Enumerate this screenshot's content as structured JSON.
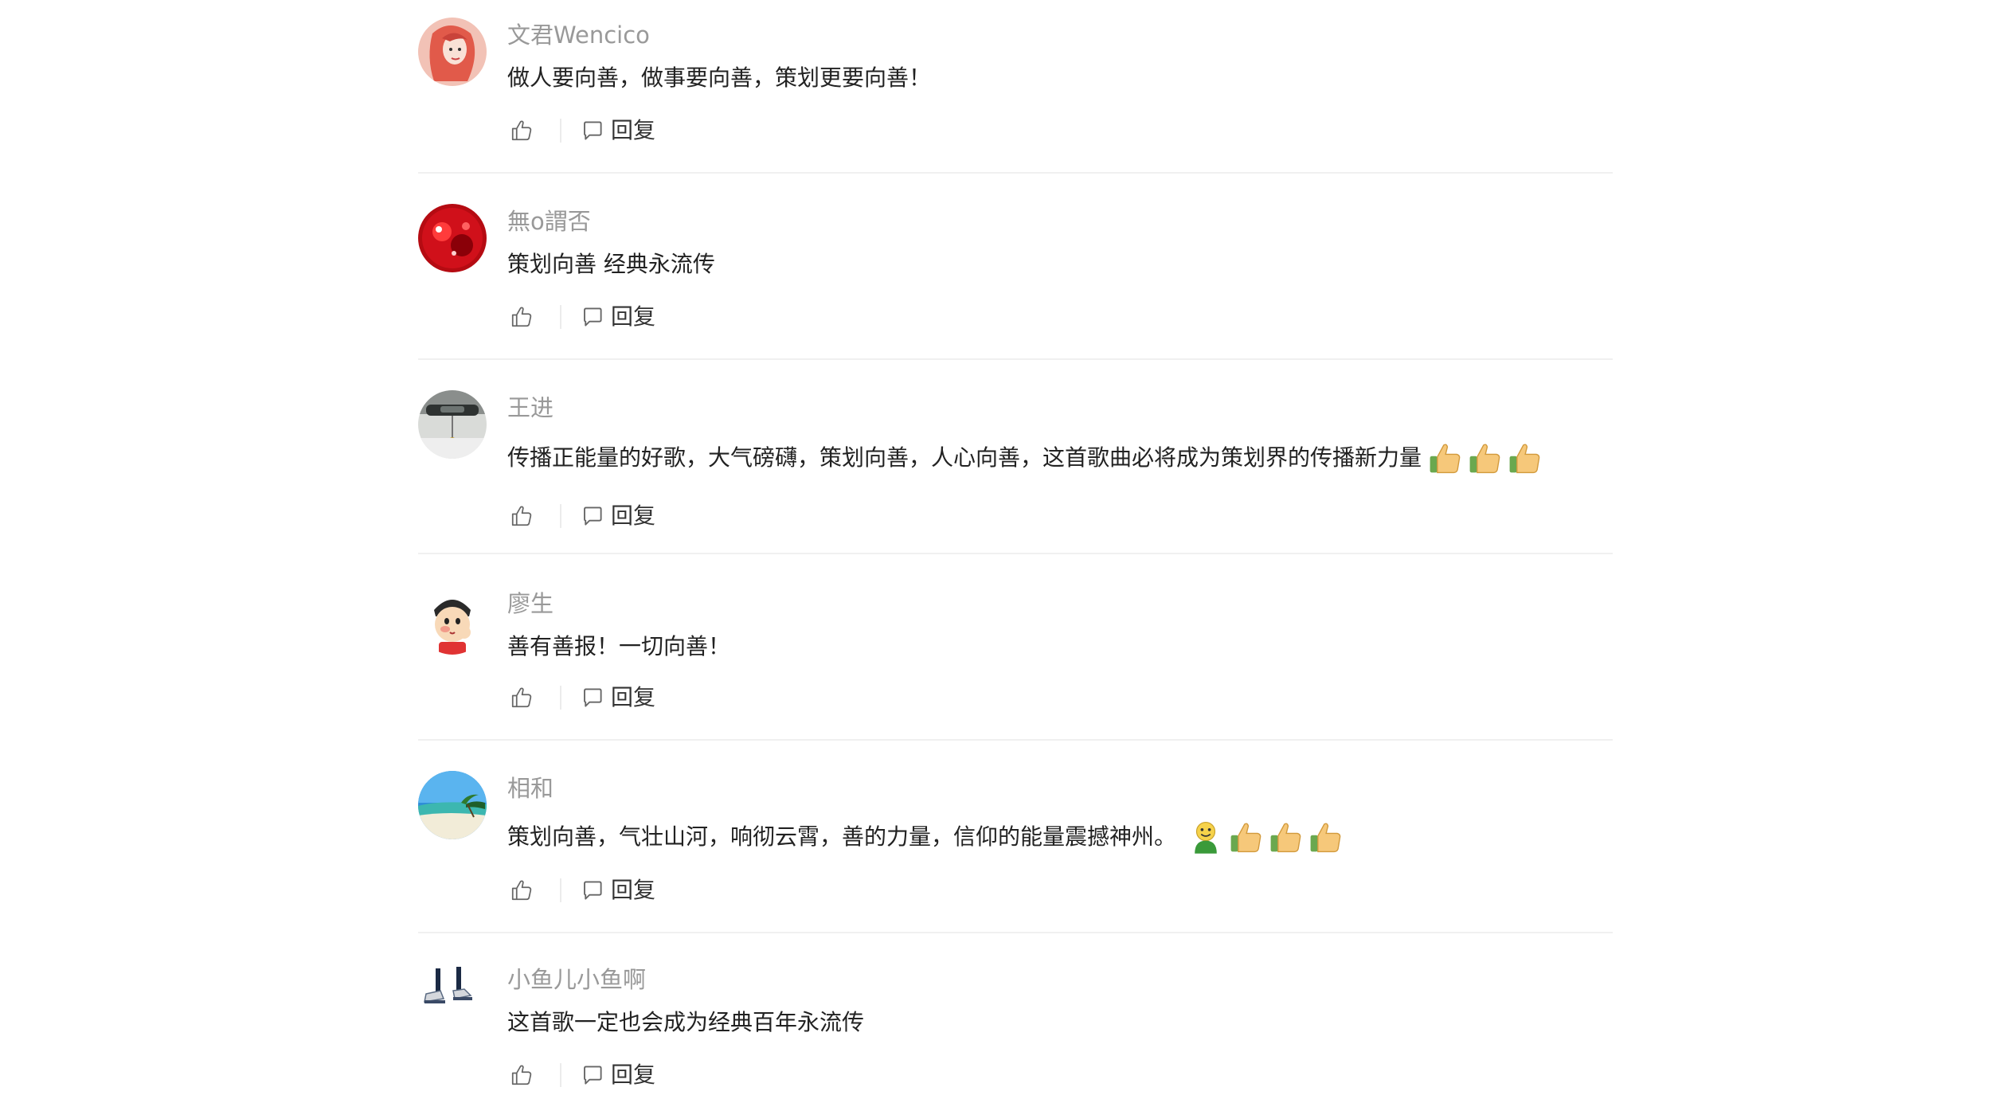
{
  "comments": [
    {
      "username": "文君Wencico",
      "content": "做人要向善，做事要向善，策划更要向善！",
      "emojis": [],
      "reply_label": "回复",
      "avatar": "woman-portrait-avatar"
    },
    {
      "username": "無o謂否",
      "content": "策划向善 经典永流传",
      "emojis": [],
      "reply_label": "回复",
      "avatar": "red-abstract-avatar"
    },
    {
      "username": "王进",
      "content": "传播正能量的好歌，大气磅礴，策划向善，人心向善，这首歌曲必将成为策划界的传播新力量",
      "emojis": [
        "thumbs-up",
        "thumbs-up",
        "thumbs-up"
      ],
      "reply_label": "回复",
      "avatar": "car-interior-avatar"
    },
    {
      "username": "廖生",
      "content": "善有善报！一切向善！",
      "emojis": [],
      "reply_label": "回复",
      "avatar": "cartoon-boy-avatar"
    },
    {
      "username": "相和",
      "content": "策划向善，气壮山河，响彻云霄，善的力量，信仰的能量震撼神州。",
      "emojis": [
        "smiley",
        "thumbs-up",
        "thumbs-up",
        "thumbs-up"
      ],
      "reply_label": "回复",
      "avatar": "beach-avatar"
    },
    {
      "username": "小鱼儿小鱼啊",
      "content": "这首歌一定也会成为经典百年永流传",
      "emojis": [],
      "reply_label": "回复",
      "avatar": "shoes-avatar"
    }
  ],
  "colors": {
    "username": "#999999",
    "content": "#222222",
    "divider": "#f0f0f0",
    "icon": "#666666"
  }
}
